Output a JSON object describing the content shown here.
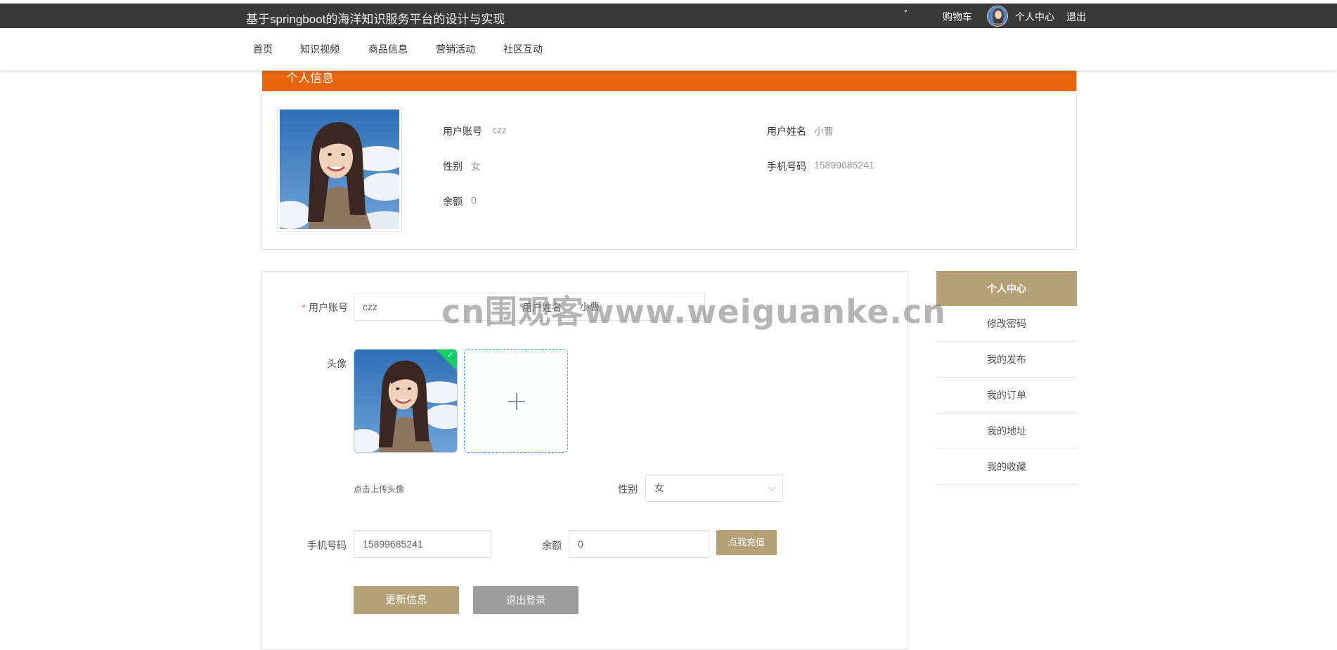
{
  "topbar": {
    "site_title": "基于springboot的海洋知识服务平台的设计与实现",
    "dot": "°",
    "cart": "购物车",
    "personal_center": "个人中心",
    "logout": "退出"
  },
  "nav": {
    "items": [
      {
        "label": "首页"
      },
      {
        "label": "知识视频"
      },
      {
        "label": "商品信息"
      },
      {
        "label": "营销活动"
      },
      {
        "label": "社区互动"
      }
    ]
  },
  "profile": {
    "header": "个人信息",
    "account_label": "用户账号",
    "account_value": "czz",
    "name_label": "用户姓名",
    "name_value": "小曹",
    "gender_label": "性别",
    "gender_value": "女",
    "phone_label": "手机号码",
    "phone_value": "15899685241",
    "balance_label": "余额",
    "balance_value": "0"
  },
  "form": {
    "account_label": "用户账号",
    "account_value": "czz",
    "name_label": "用户姓名",
    "name_value": "小曹",
    "avatar_label": "头像",
    "upload_tip": "点击上传头像",
    "gender_label": "性别",
    "gender_value": "女",
    "phone_label": "手机号码",
    "phone_value": "15899685241",
    "balance_label": "余额",
    "balance_value": "0",
    "recharge_button": "点我充值",
    "update_button": "更新信息",
    "logout_button": "退出登录"
  },
  "sidebar": {
    "title": "个人中心",
    "items": [
      {
        "label": "修改密码"
      },
      {
        "label": "我的发布"
      },
      {
        "label": "我的订单"
      },
      {
        "label": "我的地址"
      },
      {
        "label": "我的收藏"
      }
    ]
  },
  "watermark": "cn围观客www.weiguanke.cn",
  "colors": {
    "topbar": "#3a3a3a",
    "profile_header": "#e8650b",
    "accent": "#b5a178",
    "logout_button": "#9c9c9c",
    "required": "#f56c6c"
  }
}
